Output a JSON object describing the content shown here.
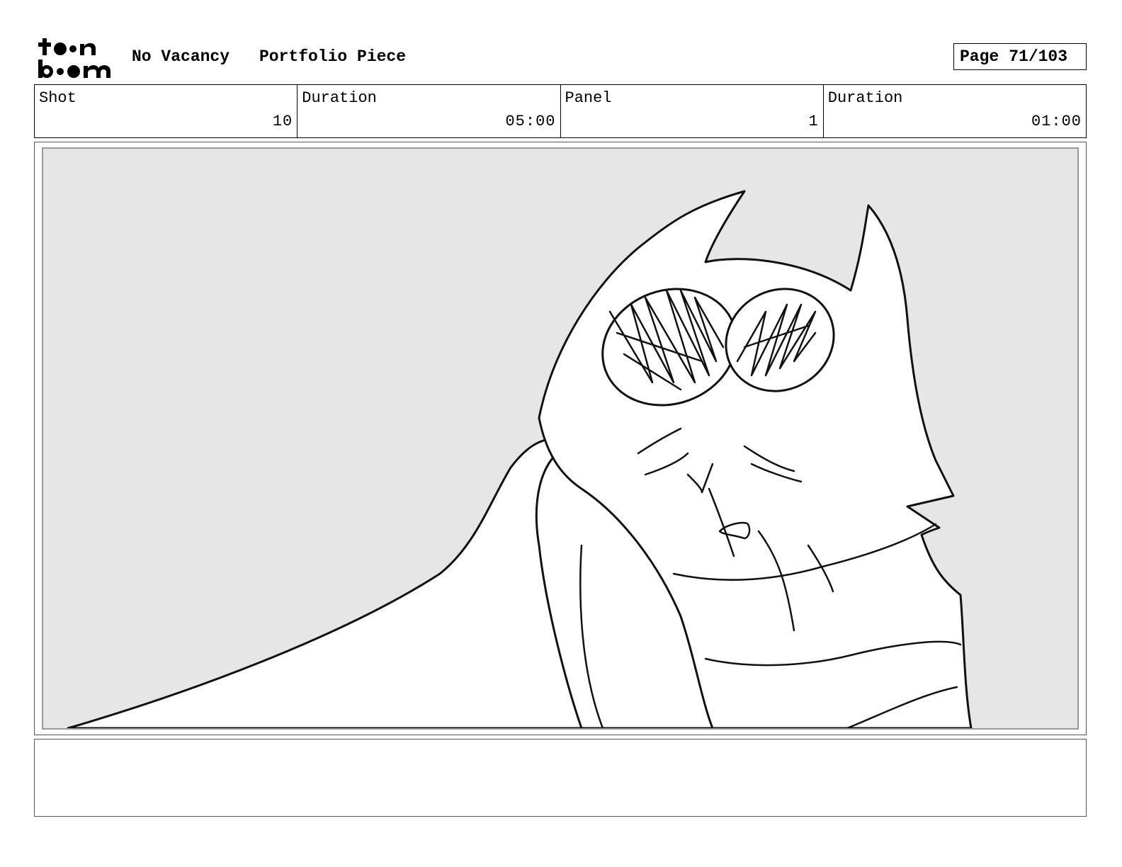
{
  "header": {
    "logo_alt": "toon boom",
    "project_title": "No Vacancy",
    "piece_title": "Portfolio Piece",
    "page_label": "Page",
    "page_number": "71/103"
  },
  "info_row": [
    {
      "label": "Shot",
      "value": "10"
    },
    {
      "label": "Duration",
      "value": "05:00"
    },
    {
      "label": "Panel",
      "value": "1"
    },
    {
      "label": "Duration",
      "value": "01:00"
    }
  ],
  "panel": {
    "background_color": "#e6e6e6",
    "line_color": "#111111",
    "fill_color": "#ffffff"
  },
  "notes": {
    "text": ""
  }
}
